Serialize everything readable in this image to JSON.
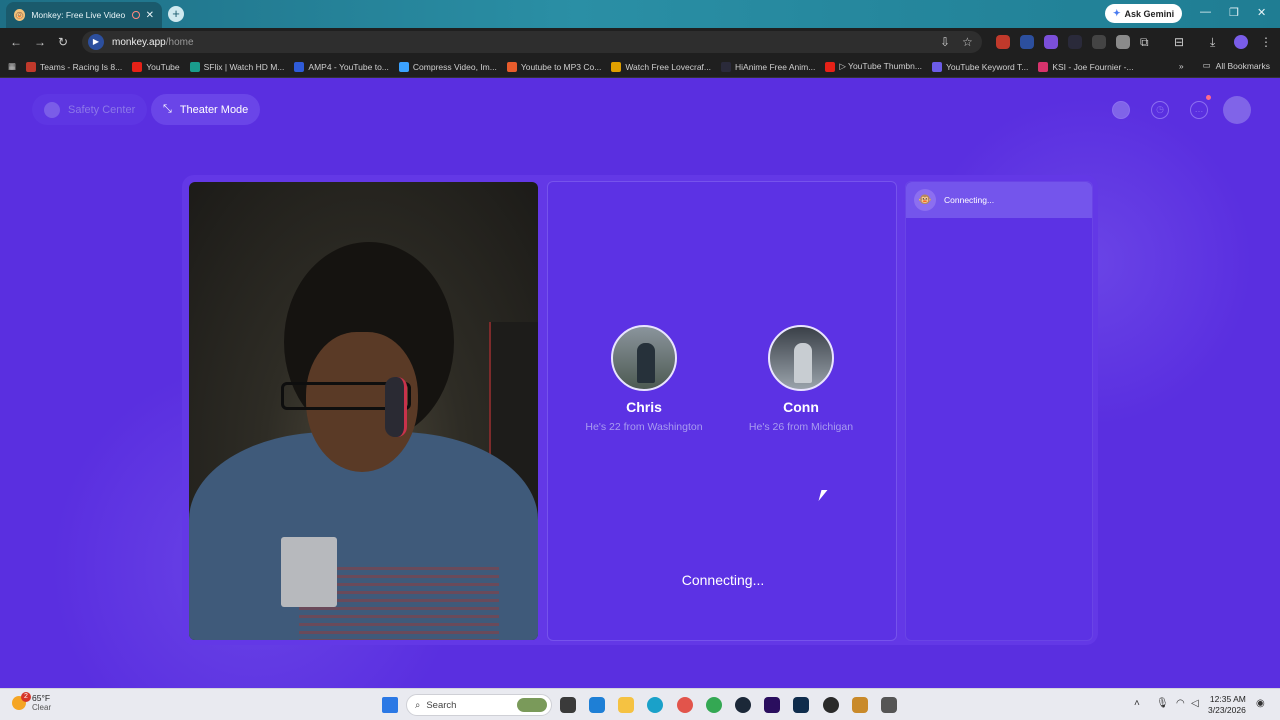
{
  "browser": {
    "tab_title": "Monkey: Free Live Video Ch",
    "url_host": "monkey.app",
    "url_path": "/home",
    "ask_gemini": "Ask Gemini",
    "all_bookmarks": "All Bookmarks",
    "bookmarks": [
      {
        "label": "Teams - Racing Is 8...",
        "color": "#c0392b"
      },
      {
        "label": "YouTube",
        "color": "#e62117"
      },
      {
        "label": "SFlix | Watch HD M...",
        "color": "#1a9c8c"
      },
      {
        "label": "AMP4 - YouTube to...",
        "color": "#2f5bd8"
      },
      {
        "label": "Compress Video, Im...",
        "color": "#3ba2ff"
      },
      {
        "label": "Youtube to MP3 Co...",
        "color": "#e85c2c"
      },
      {
        "label": "Watch Free Lovecraf...",
        "color": "#e0a000"
      },
      {
        "label": "HiAnime Free Anim...",
        "color": "#2a2a3a"
      },
      {
        "label": "▷ YouTube Thumbn...",
        "color": "#e62117"
      },
      {
        "label": "YouTube Keyword T...",
        "color": "#6c5ce7"
      },
      {
        "label": "KSI - Joe Fournier -...",
        "color": "#d6336c"
      }
    ]
  },
  "app": {
    "safety_center": "Safety Center",
    "theater_mode": "Theater Mode",
    "matches": [
      {
        "name": "Chris",
        "info": "He's 22 from Washington"
      },
      {
        "name": "Conn",
        "info": "He's 26 from Michigan"
      }
    ],
    "status": "Connecting...",
    "chat_status": "Connecting..."
  },
  "taskbar": {
    "temperature": "65°F",
    "condition": "Clear",
    "weather_badge": "2",
    "search_placeholder": "Search",
    "time": "12:35 AM",
    "date": "3/23/2026"
  }
}
